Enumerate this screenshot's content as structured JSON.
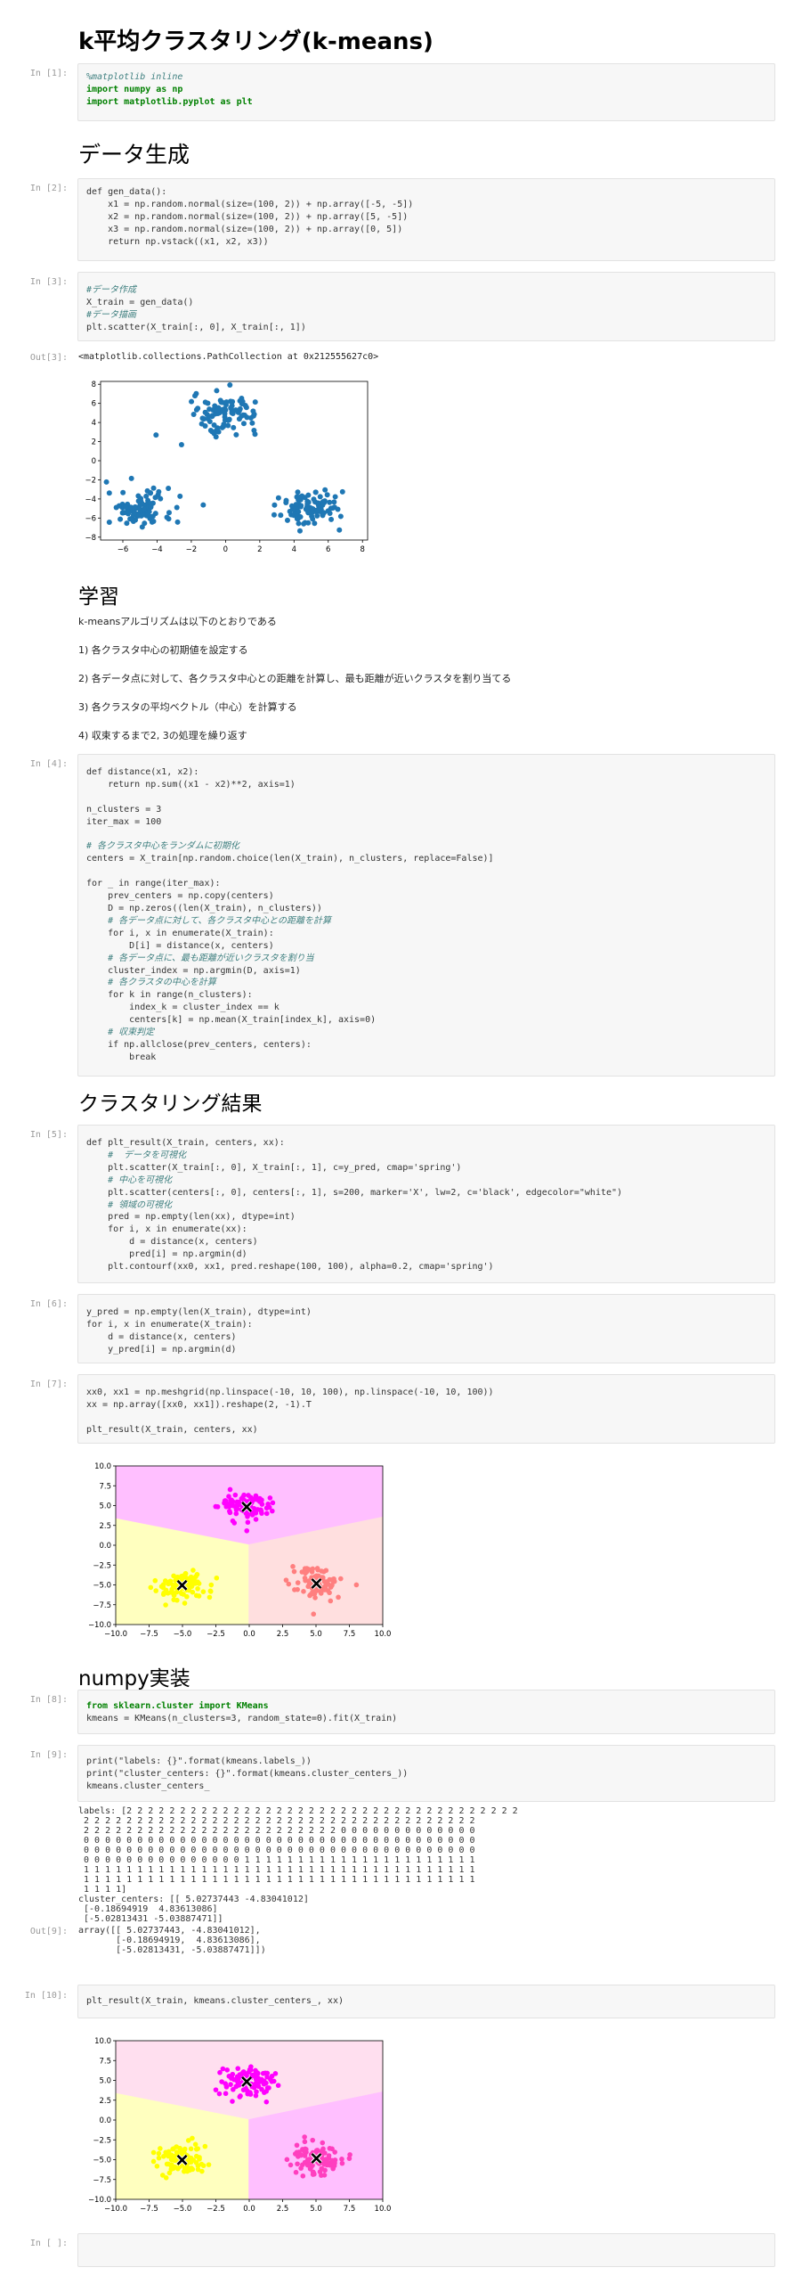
{
  "title": "k平均クラスタリング(k-means)",
  "sections": {
    "gen": "データ生成",
    "learn": "学習",
    "result": "クラスタリング結果",
    "numpy": "numpy実装"
  },
  "prompts": {
    "p1": "In [1]:",
    "p2": "In [2]:",
    "p3": "In [3]:",
    "o3": "Out[3]:",
    "p4": "In [4]:",
    "p5": "In [5]:",
    "p6": "In [6]:",
    "p7": "In [7]:",
    "p8": "In [8]:",
    "p9": "In [9]:",
    "o9": "Out[9]:",
    "p10": "In [10]:",
    "pe": "In [ ]:"
  },
  "code": {
    "c1": [
      "%matplotlib inline",
      "import numpy as np",
      "import matplotlib.pyplot as plt"
    ],
    "c2": [
      "def gen_data():",
      "    x1 = np.random.normal(size=(100, 2)) + np.array([-5, -5])",
      "    x2 = np.random.normal(size=(100, 2)) + np.array([5, -5])",
      "    x3 = np.random.normal(size=(100, 2)) + np.array([0, 5])",
      "    return np.vstack((x1, x2, x3))"
    ],
    "c3": [
      "#データ作成",
      "X_train = gen_data()",
      "#データ描画",
      "plt.scatter(X_train[:, 0], X_train[:, 1])"
    ],
    "c4": [
      "def distance(x1, x2):",
      "    return np.sum((x1 - x2)**2, axis=1)",
      "",
      "n_clusters = 3",
      "iter_max = 100",
      "",
      "# 各クラスタ中心をランダムに初期化",
      "centers = X_train[np.random.choice(len(X_train), n_clusters, replace=False)]",
      "",
      "for _ in range(iter_max):",
      "    prev_centers = np.copy(centers)",
      "    D = np.zeros((len(X_train), n_clusters))",
      "    # 各データ点に対して、各クラスタ中心との距離を計算",
      "    for i, x in enumerate(X_train):",
      "        D[i] = distance(x, centers)",
      "    # 各データ点に、最も距離が近いクラスタを割り当",
      "    cluster_index = np.argmin(D, axis=1)",
      "    # 各クラスタの中心を計算",
      "    for k in range(n_clusters):",
      "        index_k = cluster_index == k",
      "        centers[k] = np.mean(X_train[index_k], axis=0)",
      "    # 収束判定",
      "    if np.allclose(prev_centers, centers):",
      "        break"
    ],
    "c5": [
      "def plt_result(X_train, centers, xx):",
      "    #  データを可視化",
      "    plt.scatter(X_train[:, 0], X_train[:, 1], c=y_pred, cmap='spring')",
      "    # 中心を可視化",
      "    plt.scatter(centers[:, 0], centers[:, 1], s=200, marker='X', lw=2, c='black', edgecolor=\"white\")",
      "    # 領域の可視化",
      "    pred = np.empty(len(xx), dtype=int)",
      "    for i, x in enumerate(xx):",
      "        d = distance(x, centers)",
      "        pred[i] = np.argmin(d)",
      "    plt.contourf(xx0, xx1, pred.reshape(100, 100), alpha=0.2, cmap='spring')"
    ],
    "c6": [
      "y_pred = np.empty(len(X_train), dtype=int)",
      "for i, x in enumerate(X_train):",
      "    d = distance(x, centers)",
      "    y_pred[i] = np.argmin(d)"
    ],
    "c7": [
      "xx0, xx1 = np.meshgrid(np.linspace(-10, 10, 100), np.linspace(-10, 10, 100))",
      "xx = np.array([xx0, xx1]).reshape(2, -1).T",
      "",
      "plt_result(X_train, centers, xx)"
    ],
    "c8": [
      "from sklearn.cluster import KMeans",
      "kmeans = KMeans(n_clusters=3, random_state=0).fit(X_train)"
    ],
    "c9": [
      "print(\"labels: {}\".format(kmeans.labels_))",
      "print(\"cluster_centers: {}\".format(kmeans.cluster_centers_))",
      "kmeans.cluster_centers_"
    ],
    "c10": [
      "plt_result(X_train, kmeans.cluster_centers_, xx)"
    ]
  },
  "learn_text": [
    "k-meansアルゴリズムは以下のとおりである",
    "1) 各クラスタ中心の初期値を設定する",
    "2) 各データ点に対して、各クラスタ中心との距離を計算し、最も距離が近いクラスタを割り当てる",
    "3) 各クラスタの平均ベクトル（中心）を計算する",
    "4) 収束するまで2, 3の処理を繰り返す"
  ],
  "out3": "<matplotlib.collections.PathCollection at 0x212555627c0>",
  "out9_stdout": [
    "labels: [2 2 2 2 2 2 2 2 2 2 2 2 2 2 2 2 2 2 2 2 2 2 2 2 2 2 2 2 2 2 2 2 2 2 2 2 2",
    " 2 2 2 2 2 2 2 2 2 2 2 2 2 2 2 2 2 2 2 2 2 2 2 2 2 2 2 2 2 2 2 2 2 2 2 2 2",
    " 2 2 2 2 2 2 2 2 2 2 2 2 2 2 2 2 2 2 2 2 2 2 2 2 0 0 0 0 0 0 0 0 0 0 0 0 0",
    " 0 0 0 0 0 0 0 0 0 0 0 0 0 0 0 0 0 0 0 0 0 0 0 0 0 0 0 0 0 0 0 0 0 0 0 0 0",
    " 0 0 0 0 0 0 0 0 0 0 0 0 0 0 0 0 0 0 0 0 0 0 0 0 0 0 0 0 0 0 0 0 0 0 0 0 0",
    " 0 0 0 0 0 0 0 0 0 0 0 0 0 0 0 1 1 1 1 1 1 1 1 1 1 1 1 1 1 1 1 1 1 1 1 1 1",
    " 1 1 1 1 1 1 1 1 1 1 1 1 1 1 1 1 1 1 1 1 1 1 1 1 1 1 1 1 1 1 1 1 1 1 1 1 1",
    " 1 1 1 1 1 1 1 1 1 1 1 1 1 1 1 1 1 1 1 1 1 1 1 1 1 1 1 1 1 1 1 1 1 1 1 1 1",
    " 1 1 1 1]",
    "cluster_centers: [[ 5.02737443 -4.83041012]",
    " [-0.18694919  4.83613086]",
    " [-5.02813431 -5.03887471]]"
  ],
  "out9_value": [
    "array([[ 5.02737443, -4.83041012],",
    "       [-0.18694919,  4.83613086],",
    "       [-5.02813431, -5.03887471]])"
  ],
  "colors": {
    "blue": "#1f77b4",
    "magenta": "#ff00ff",
    "yellow": "#ffff00",
    "salmon": "#ff7f7f",
    "pink": "#ff3fbf",
    "orange": "#ff9f5f"
  },
  "chart_data": [
    {
      "type": "scatter",
      "title": "",
      "xlim": [
        -7.3,
        8.3
      ],
      "ylim": [
        -8.3,
        8.3
      ],
      "xticks": [
        "−6",
        "−4",
        "−2",
        "0",
        "2",
        "4",
        "6",
        "8"
      ],
      "yticks": [
        "8",
        "6",
        "4",
        "2",
        "0",
        "−2",
        "−4",
        "−6",
        "−8"
      ],
      "clusters": [
        [
          -5,
          -5
        ],
        [
          5,
          -5
        ],
        [
          0,
          5
        ]
      ],
      "color": "#1f77b4"
    },
    {
      "type": "scatter",
      "title": "",
      "xlim": [
        -10,
        10
      ],
      "ylim": [
        -10,
        10
      ],
      "xticks": [
        "−10.0",
        "−7.5",
        "−5.0",
        "−2.5",
        "0.0",
        "2.5",
        "5.0",
        "7.5",
        "10.0"
      ],
      "yticks": [
        "10.0",
        "7.5",
        "5.0",
        "2.5",
        "0.0",
        "−2.5",
        "−5.0",
        "−7.5",
        "−10.0"
      ],
      "centers": [
        [
          5.03,
          -4.83
        ],
        [
          -0.19,
          4.84
        ],
        [
          -5.03,
          -5.04
        ]
      ],
      "cluster_colors": [
        "#ff7f7f",
        "#ff00ff",
        "#ffff00"
      ]
    },
    {
      "type": "scatter",
      "title": "",
      "xlim": [
        -10,
        10
      ],
      "ylim": [
        -10,
        10
      ],
      "xticks": [
        "−10.0",
        "−7.5",
        "−5.0",
        "−2.5",
        "0.0",
        "2.5",
        "5.0",
        "7.5",
        "10.0"
      ],
      "yticks": [
        "10.0",
        "7.5",
        "5.0",
        "2.5",
        "0.0",
        "−2.5",
        "−5.0",
        "−7.5",
        "−10.0"
      ],
      "centers": [
        [
          5.03,
          -4.83
        ],
        [
          -0.19,
          4.84
        ],
        [
          -5.03,
          -5.04
        ]
      ],
      "cluster_colors": [
        "#ff3fbf",
        "#ff00ff",
        "#ffff00"
      ]
    }
  ]
}
